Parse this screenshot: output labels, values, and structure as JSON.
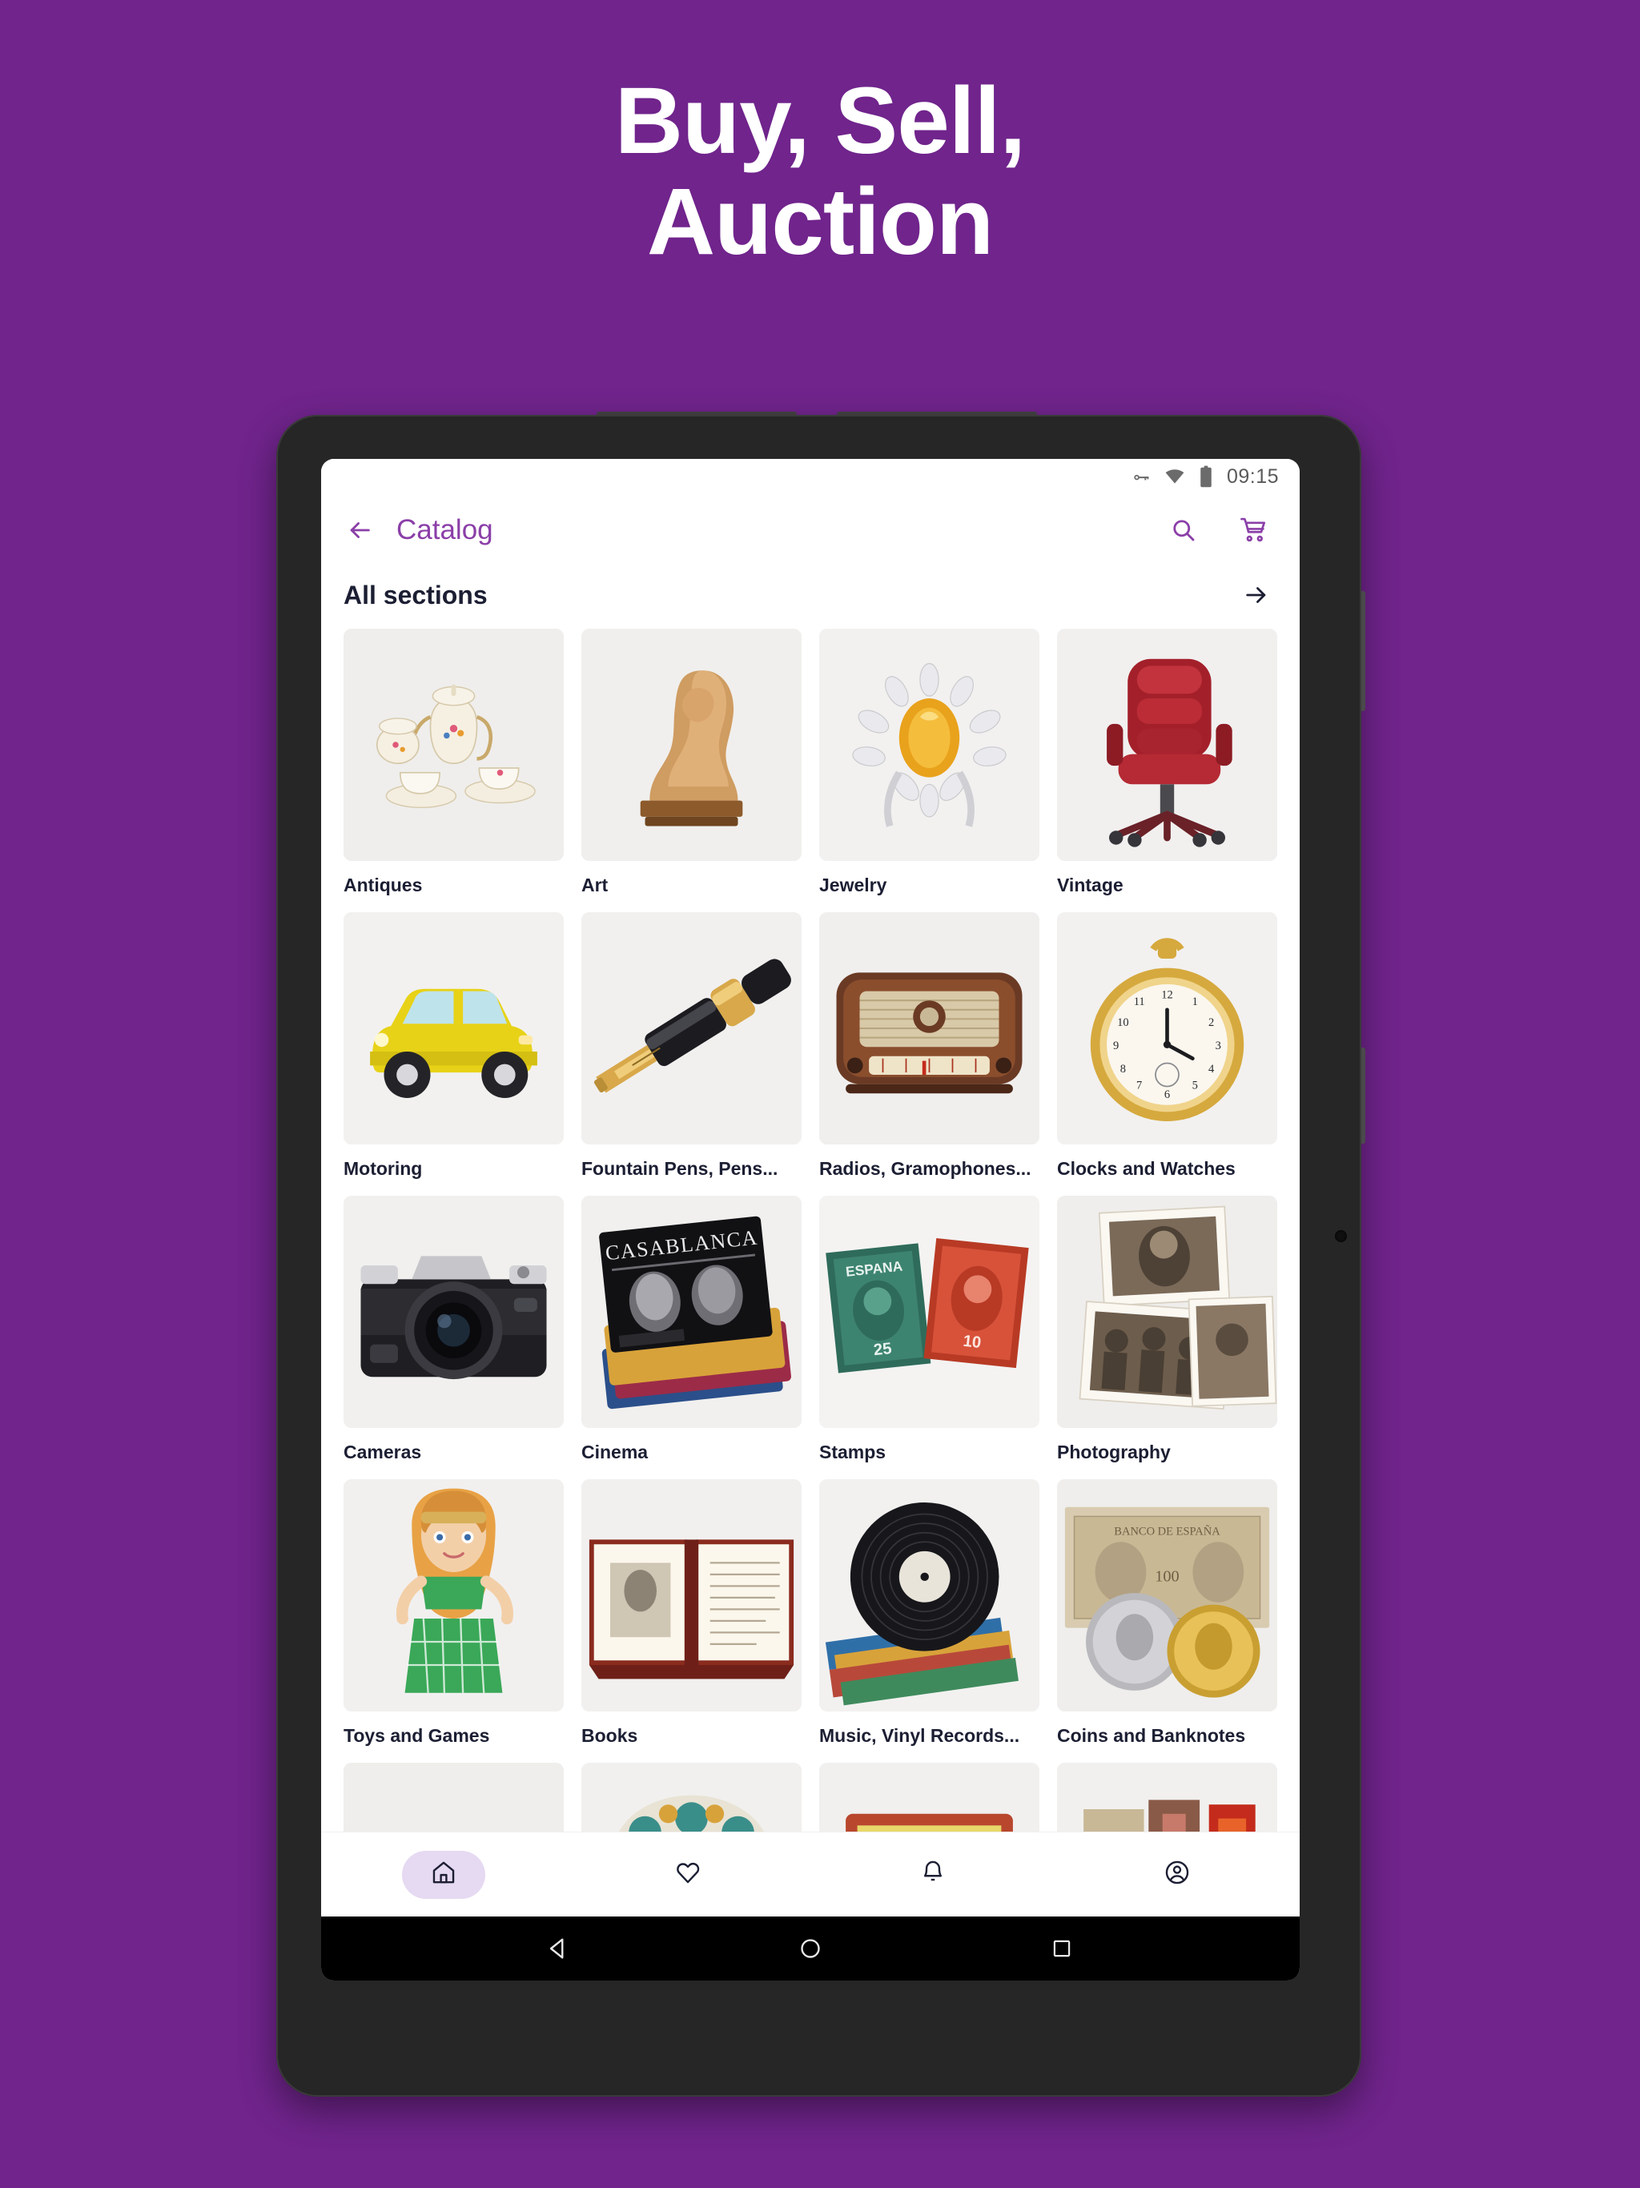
{
  "hero": {
    "line1": "Buy, Sell,",
    "line2": "Auction"
  },
  "colors": {
    "background": "#70248C",
    "accent_purple": "#8B3FA8",
    "text_dark": "#1c1f33",
    "nav_pill": "#E6D9F2",
    "device_frame": "#262626"
  },
  "status_bar": {
    "vpn_icon": "key-icon",
    "wifi_icon": "wifi-icon",
    "battery_icon": "battery-icon",
    "time": "09:15"
  },
  "app_bar": {
    "back_icon": "back-arrow-icon",
    "title": "Catalog",
    "search_icon": "search-icon",
    "cart_icon": "shopping-cart-icon"
  },
  "section": {
    "title": "All sections",
    "arrow_icon": "arrow-right-icon"
  },
  "grid": {
    "items": [
      {
        "label": "Antiques",
        "image": "porcelain-tea-set"
      },
      {
        "label": "Art",
        "image": "carved-wood-bust"
      },
      {
        "label": "Jewelry",
        "image": "citrine-diamond-ring"
      },
      {
        "label": "Vintage",
        "image": "red-leather-office-chair"
      },
      {
        "label": "Motoring",
        "image": "yellow-classic-car"
      },
      {
        "label": "Fountain Pens, Pens...",
        "image": "gold-nib-fountain-pen"
      },
      {
        "label": "Radios, Gramophones...",
        "image": "vintage-wooden-radio"
      },
      {
        "label": "Clocks and Watches",
        "image": "gold-pocket-watch"
      },
      {
        "label": "Cameras",
        "image": "vintage-slr-camera"
      },
      {
        "label": "Cinema",
        "image": "casablanca-movie-posters"
      },
      {
        "label": "Stamps",
        "image": "espana-postage-stamps"
      },
      {
        "label": "Photography",
        "image": "sepia-vintage-photographs"
      },
      {
        "label": "Toys and Games",
        "image": "vintage-fashion-doll"
      },
      {
        "label": "Books",
        "image": "open-antique-book"
      },
      {
        "label": "Music, Vinyl Records...",
        "image": "vinyl-record-stack"
      },
      {
        "label": "Coins and Banknotes",
        "image": "old-coins-and-banknotes"
      }
    ],
    "partial_row": [
      {
        "image": "partial-blank"
      },
      {
        "image": "partial-ceramic-plate"
      },
      {
        "image": "partial-yellow-frame"
      },
      {
        "image": "partial-bookshelf"
      }
    ]
  },
  "bottom_nav": {
    "items": [
      {
        "icon": "home-icon",
        "active": true
      },
      {
        "icon": "heart-icon",
        "active": false
      },
      {
        "icon": "bell-icon",
        "active": false
      },
      {
        "icon": "account-icon",
        "active": false
      }
    ]
  },
  "android_nav": {
    "back_icon": "android-back-icon",
    "home_icon": "android-home-icon",
    "recents_icon": "android-recents-icon"
  }
}
